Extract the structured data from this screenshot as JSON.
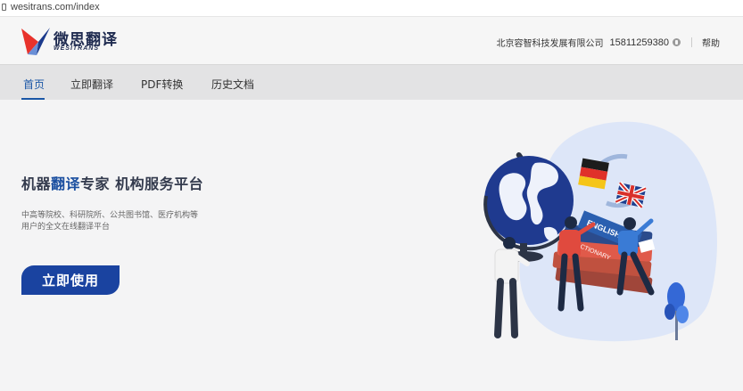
{
  "browser": {
    "url": "wesitrans.com/index"
  },
  "header": {
    "logo_cn": "微思翻译",
    "logo_en": "WESITRANS",
    "company": "北京容智科技发展有限公司",
    "phone": "15811259380",
    "help": "帮助"
  },
  "nav": {
    "tabs": [
      {
        "label": "首页"
      },
      {
        "label": "立即翻译"
      },
      {
        "label": "PDF转换"
      },
      {
        "label": "历史文档"
      }
    ]
  },
  "hero": {
    "title_part1": "机器",
    "title_highlight": "翻译",
    "title_part2": "专家 机构服务平台",
    "desc": "中高等院校、科研院所、公共图书馆、医疗机构等用户的全文在线翻译平台",
    "cta": "立即使用"
  },
  "illustration": {
    "book_spine_1": "ENGLISH",
    "book_spine_2": "DICTIONARY"
  },
  "colors": {
    "accent": "#1b57a6",
    "button": "#1a43a0",
    "blob": "#dde6f8"
  }
}
